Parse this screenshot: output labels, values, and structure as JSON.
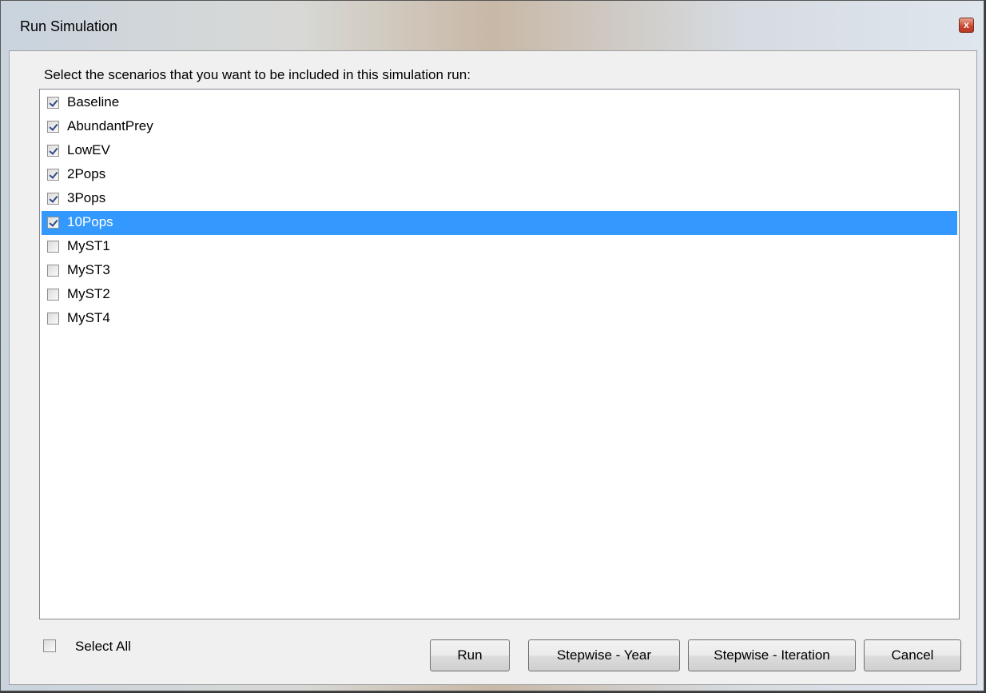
{
  "window": {
    "title": "Run Simulation",
    "close_glyph": "x"
  },
  "instruction": "Select the scenarios that you want to be included in this simulation run:",
  "scenarios": [
    {
      "label": "Baseline",
      "checked": true
    },
    {
      "label": "AbundantPrey",
      "checked": true
    },
    {
      "label": "LowEV",
      "checked": true
    },
    {
      "label": "2Pops",
      "checked": true
    },
    {
      "label": "3Pops",
      "checked": true
    },
    {
      "label": "10Pops",
      "checked": true,
      "selected": true
    },
    {
      "label": "MyST1",
      "checked": false
    },
    {
      "label": "MyST3",
      "checked": false
    },
    {
      "label": "MyST2",
      "checked": false
    },
    {
      "label": "MyST4",
      "checked": false
    }
  ],
  "select_all": {
    "label": "Select All",
    "checked": false
  },
  "buttons": {
    "run": "Run",
    "stepwise_year": "Stepwise - Year",
    "stepwise_iteration": "Stepwise - Iteration",
    "cancel": "Cancel"
  },
  "colors": {
    "selection": "#3399ff",
    "close_button": "#c8452e"
  }
}
